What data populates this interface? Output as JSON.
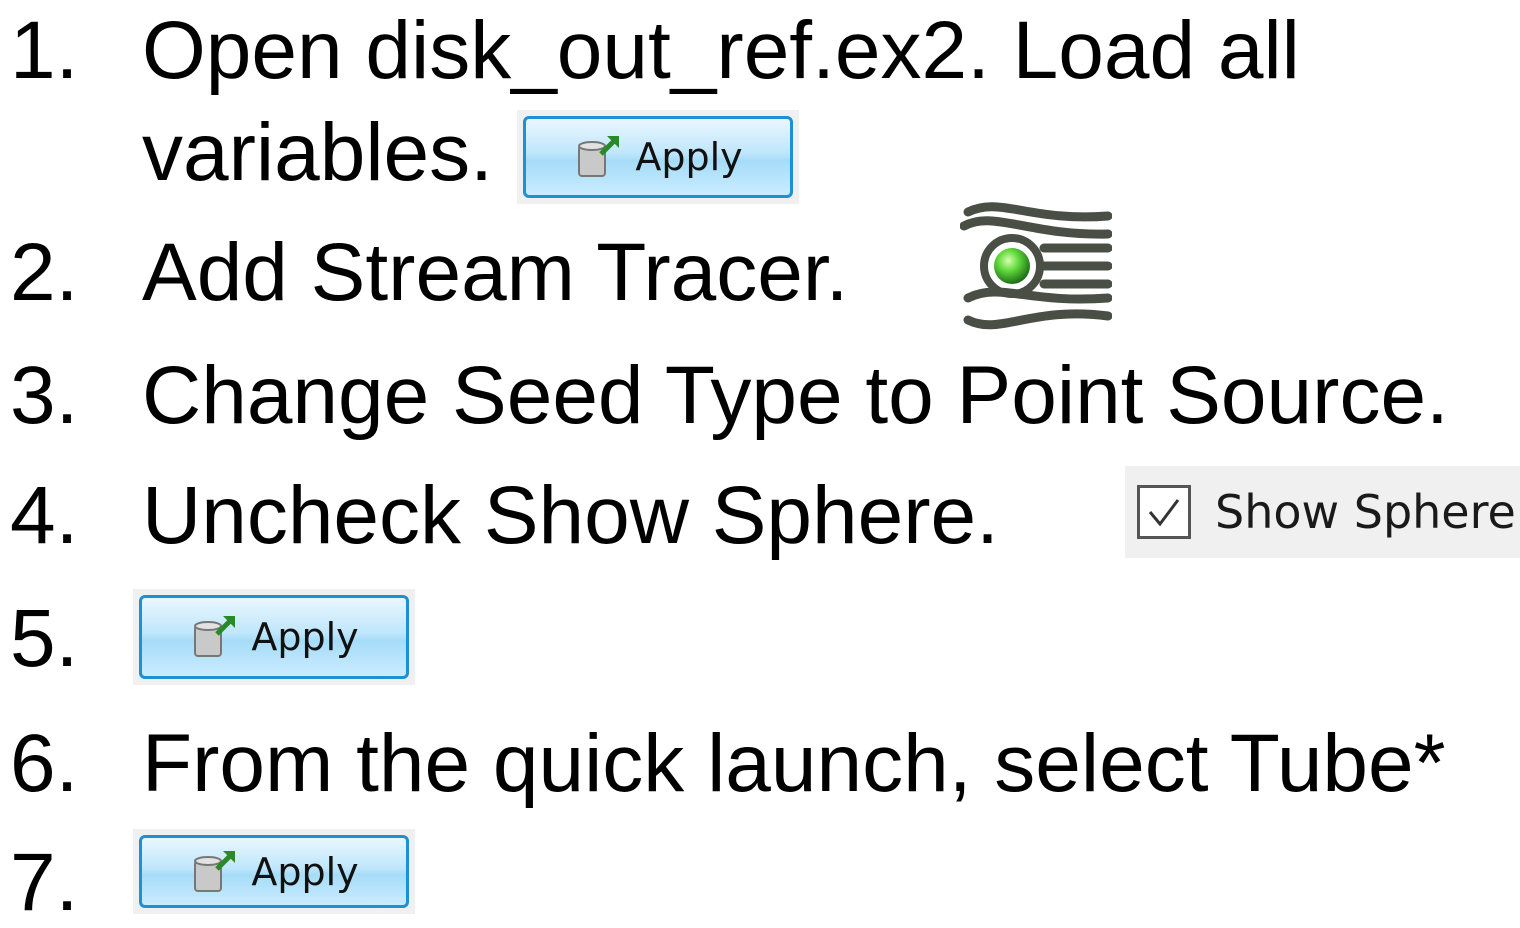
{
  "steps": [
    {
      "number": "1.",
      "line1": "Open disk_out_ref.ex2.  Load all",
      "line2": "variables."
    },
    {
      "number": "2.",
      "text": "Add Stream Tracer."
    },
    {
      "number": "3.",
      "text": "Change Seed Type to Point Source."
    },
    {
      "number": "4.",
      "text": "Uncheck Show Sphere."
    },
    {
      "number": "5."
    },
    {
      "number": "6.",
      "text": "From the quick launch, select Tube*"
    },
    {
      "number": "7."
    }
  ],
  "apply_button": {
    "label": "Apply",
    "icon": "apply-icon"
  },
  "show_sphere": {
    "label": "Show Sphere",
    "checked": true
  },
  "stream_tracer_icon": {
    "icon": "stream-tracer-icon"
  },
  "colors": {
    "button_border": "#1f8fd6",
    "button_fill": "#bfe6fb",
    "tracer_green": "#5fd93a",
    "tracer_lines": "#4a4f45"
  }
}
